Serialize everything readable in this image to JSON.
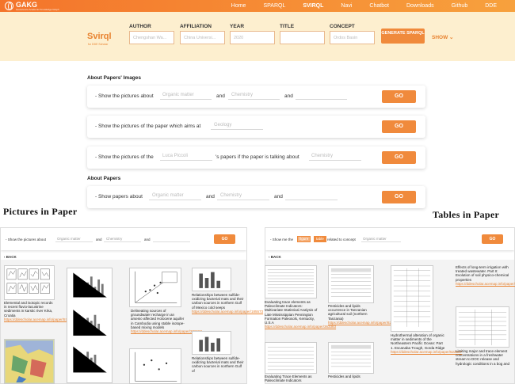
{
  "topbar": {
    "logo_name": "GAKG",
    "logo_sub": "Geoscience Academic Knowledge Graph",
    "nav": [
      "Home",
      "SPARQL",
      "SVIRQL",
      "Navi",
      "Chatbot",
      "Downloads",
      "Github",
      "DDE"
    ],
    "active": "SVIRQL"
  },
  "svirql": {
    "title": "Svirql",
    "subtitle": "for DDE Scholar",
    "fields": [
      {
        "label": "AUTHOR",
        "placeholder": "Chengshan Wa..."
      },
      {
        "label": "AFFILIATION",
        "placeholder": "China Universi..."
      },
      {
        "label": "YEAR",
        "placeholder": "2020"
      },
      {
        "label": "TITLE",
        "placeholder": ""
      },
      {
        "label": "CONCEPT",
        "placeholder": "Ordos Basin"
      }
    ],
    "generate_label": "GENERATE SPARQL",
    "show_label": "SHOW"
  },
  "images_section": {
    "title": "About Papers' Images",
    "q1": {
      "t1": "- Show the pictures about",
      "in1": "Organic matter",
      "t2": "and",
      "in2": "Chemistry",
      "t3": "and",
      "in3": ""
    },
    "q2": {
      "t1": "- Show the pictures of the paper which aims at",
      "in1": "Geology"
    },
    "q3": {
      "t1": "- Show the pictures of the",
      "in1": "Luca Piccoli",
      "t2": "'s papers if the paper is talking about",
      "in2": "Chemistry"
    }
  },
  "papers_section": {
    "title": "About Papers",
    "q1": {
      "t1": "- Show papers about",
      "in1": "Organic matter",
      "t2": "and",
      "in2": "Chemistry",
      "t3": "and",
      "in3": ""
    }
  },
  "go_label": "GO",
  "headings": {
    "left": "Pictures in Paper",
    "right": "Tables in Paper"
  },
  "left_panel": {
    "t1": "- Show the pictures about",
    "in1": "Organic matter",
    "t2": "and",
    "in2": "Chemistry",
    "t3": "and",
    "back": "BACK",
    "captions": [
      {
        "text": "Elemental and isotopic records in recent fluvio-lacustrine sediments in karstic river Krka, Croatia",
        "link": "https://ddescholar.acemap.info/paper/573817"
      },
      {
        "text": "Delineating sources of groundwater recharge in an arsenic-affected Holocene aquifer in Cambodia using stable isotope-based mixing models",
        "link": "https://ddescholar.acemap.info/paper/286582"
      },
      {
        "text": "Relationships between sulfide-oxidizing bacterial mats and their carbon sources in northern Gulf of Mexico cold seeps",
        "link": "https://ddescholar.acemap.info/paper/185573"
      },
      {
        "text": "Relationships between sulfide-oxidizing bacterial mats and their carbon sources in northern Gulf of",
        "link": ""
      }
    ]
  },
  "right_panel": {
    "t1": "- Show me the",
    "tag1": "figure",
    "tag2": "table",
    "t2": "related to concept",
    "in1": "Organic matter",
    "back": "BACK",
    "captions": [
      {
        "text": "Evaluating trace elements as Paleoclimate Indicators: Multivariate Statistical Analysis of Late Mississippian Pennington Formation Paleosols, Kentucky, U.S.A",
        "link": "https://ddescholar.acemap.info/paper/363383"
      },
      {
        "text": "Pesticides and lipids occurrence in Tanzanian agricultural soil (northern Tanzania)",
        "link": "https://ddescholar.acemap.info/paper/822297"
      },
      {
        "text": "Hydrothermal alteration of organic matter in sediments of the Northeastern Pacific Ocean: Part 1. Escanaba Trough, Gorda Ridge",
        "link": "https://ddescholar.acemap.info/paper/522837"
      },
      {
        "text": "Effects of long-term irrigation with treated wastewater. Part II: Evolution of soil physico-chemical properties",
        "link": "https://ddescholar.acemap.info/paper/29889"
      },
      {
        "text": "Evaluating Trace Elements as Paleoclimate Indicators",
        "link": ""
      },
      {
        "text": "Pesticides and lipids",
        "link": ""
      },
      {
        "text": "Limiting major and trace element concentrations in a freshwater stream to DOC release and hydrologic conditions in a bog and",
        "link": ""
      }
    ]
  },
  "colors": {
    "accent": "#f08a3c",
    "banner": "#fdefcf"
  }
}
